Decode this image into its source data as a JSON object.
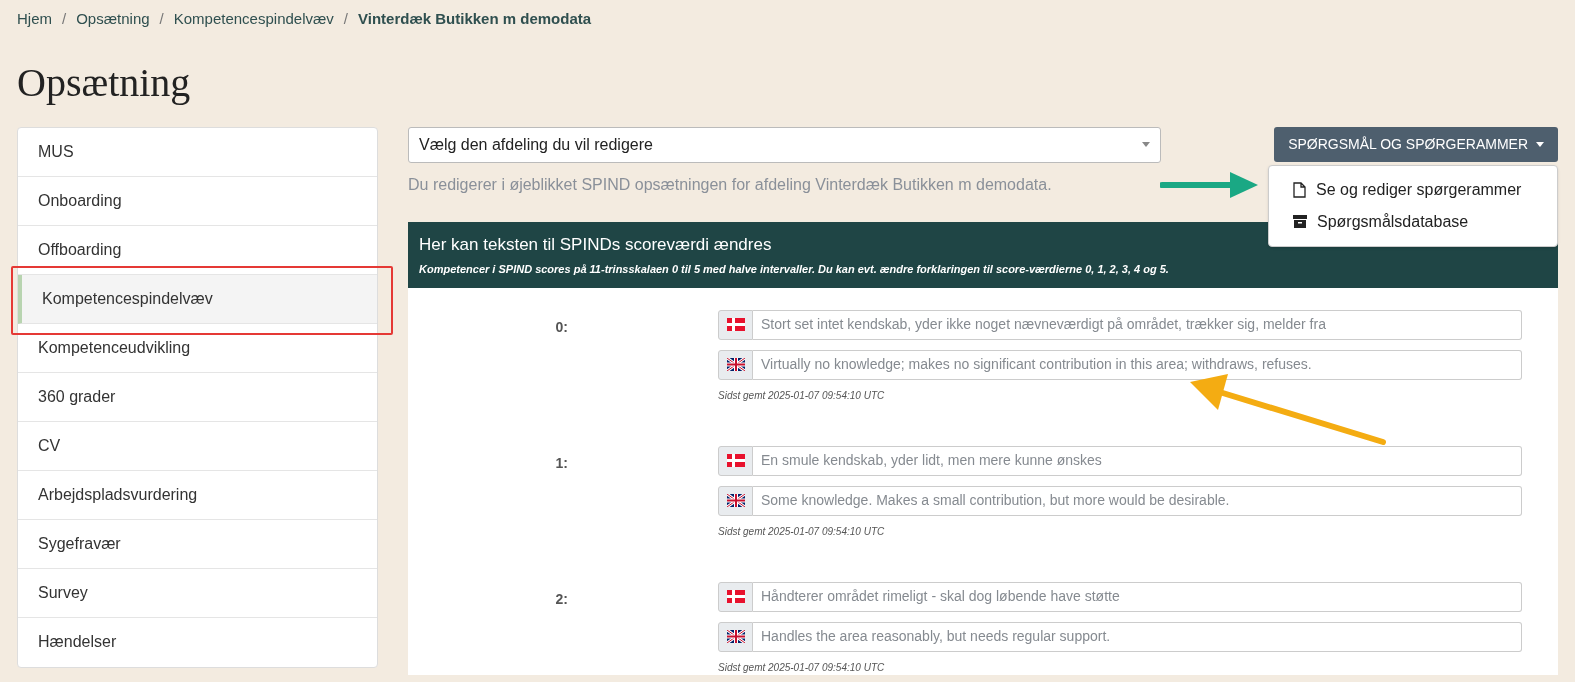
{
  "breadcrumb": [
    {
      "label": "Hjem",
      "current": false
    },
    {
      "label": "Opsætning",
      "current": false
    },
    {
      "label": "Kompetencespindelvæv",
      "current": false
    },
    {
      "label": "Vinterdæk Butikken m demodata",
      "current": true
    }
  ],
  "breadcrumb_separator": "/",
  "page_title": "Opsætning",
  "sidebar": {
    "items": [
      {
        "label": "MUS",
        "selected": false
      },
      {
        "label": "Onboarding",
        "selected": false
      },
      {
        "label": "Offboarding",
        "selected": false
      },
      {
        "label": "Kompetencespindelvæv",
        "selected": true
      },
      {
        "label": "Kompetenceudvikling",
        "selected": false
      },
      {
        "label": "360 grader",
        "selected": false
      },
      {
        "label": "CV",
        "selected": false
      },
      {
        "label": "Arbejdspladsvurdering",
        "selected": false
      },
      {
        "label": "Sygefravær",
        "selected": false
      },
      {
        "label": "Survey",
        "selected": false
      },
      {
        "label": "Hændelser",
        "selected": false
      }
    ]
  },
  "department_select": {
    "placeholder": "Vælg den afdeling du vil redigere"
  },
  "info_text": "Du redigerer i øjeblikket SPIND opsætningen for afdeling Vinterdæk Butikken m demodata.",
  "menu_button": {
    "label": "SPØRGSMÅL OG SPØRGERAMMER",
    "expanded": true
  },
  "menu_items": [
    {
      "label": "Se og rediger spørgerammer",
      "kind": "file"
    },
    {
      "label": "Spørgsmålsdatabase",
      "kind": "archive"
    }
  ],
  "panel": {
    "title": "Her kan teksten til SPINDs scoreværdi ændres",
    "subtitle": "Kompetencer i SPIND scores på 11-trinsskalaen 0 til 5 med halve intervaller. Du kan evt. ændre forklaringen til score-værdierne 0, 1, 2, 3, 4 og 5."
  },
  "scores": [
    {
      "label": "0:",
      "fields": [
        {
          "kind": "da",
          "placeholder": "Stort set intet kendskab, yder ikke noget nævneværdigt på området, trækker sig, melder fra"
        },
        {
          "kind": "en",
          "placeholder": "Virtually no knowledge; makes no significant contribution in this area; withdraws, refuses."
        }
      ],
      "saved": "Sidst gemt 2025-01-07 09:54:10 UTC"
    },
    {
      "label": "1:",
      "fields": [
        {
          "kind": "da",
          "placeholder": "En smule kendskab, yder lidt, men mere kunne ønskes"
        },
        {
          "kind": "en",
          "placeholder": "Some knowledge. Makes a small contribution, but more would be desirable."
        }
      ],
      "saved": "Sidst gemt 2025-01-07 09:54:10 UTC"
    },
    {
      "label": "2:",
      "fields": [
        {
          "kind": "da",
          "placeholder": "Håndterer området rimeligt - skal dog løbende have støtte"
        },
        {
          "kind": "en",
          "placeholder": "Handles the area reasonably, but needs regular support."
        }
      ],
      "saved": "Sidst gemt 2025-01-07 09:54:10 UTC"
    }
  ]
}
